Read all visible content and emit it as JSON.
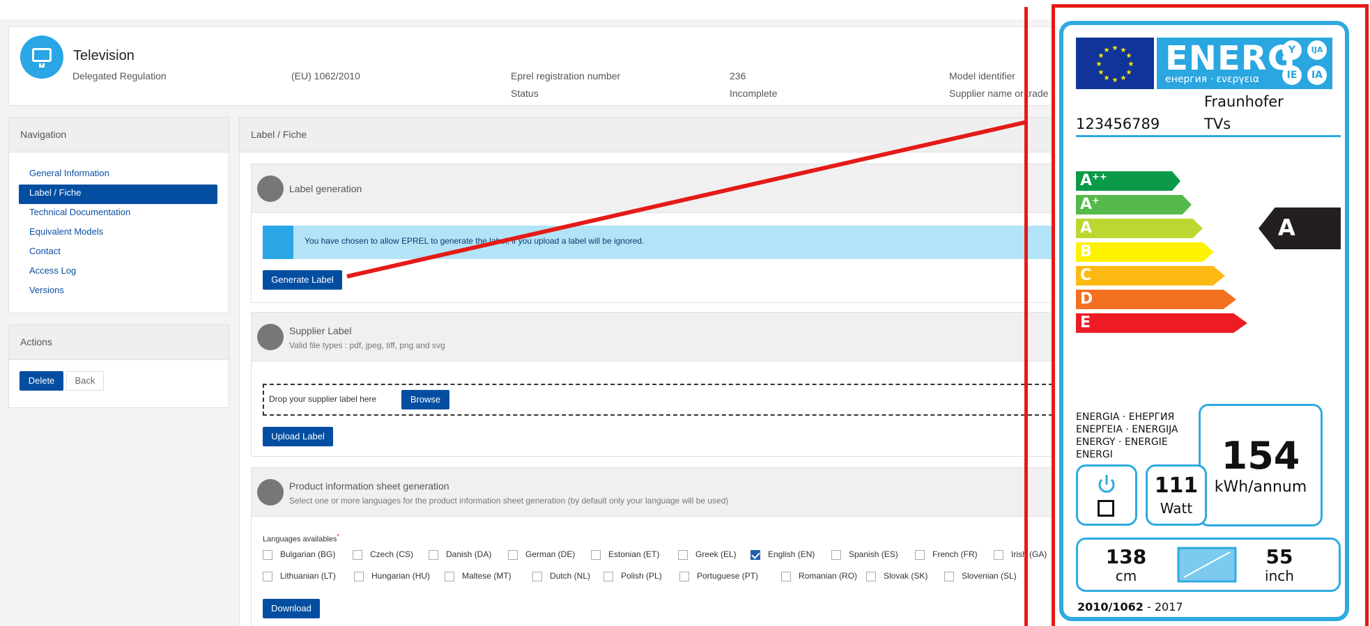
{
  "header": {
    "title": "Television",
    "fields": [
      {
        "label": "Delegated Regulation",
        "value": "(EU) 1062/2010"
      },
      {
        "label": "Eprel registration number",
        "value": "236"
      },
      {
        "label": "Status",
        "value": "Incomplete"
      },
      {
        "label": "Model identifier",
        "value": ""
      },
      {
        "label": "Supplier name or trade",
        "value": ""
      }
    ]
  },
  "navigation": {
    "title": "Navigation",
    "items": [
      {
        "label": "General Information",
        "active": false
      },
      {
        "label": "Label / Fiche",
        "active": true
      },
      {
        "label": "Technical Documentation",
        "active": false
      },
      {
        "label": "Equivalent Models",
        "active": false
      },
      {
        "label": "Contact",
        "active": false
      },
      {
        "label": "Access Log",
        "active": false
      },
      {
        "label": "Versions",
        "active": false
      }
    ]
  },
  "actions": {
    "title": "Actions",
    "delete_label": "Delete",
    "back_label": "Back"
  },
  "main": {
    "title": "Label / Fiche",
    "label_generation": {
      "title": "Label generation",
      "info": "You have chosen to allow EPREL to generate the label, if you upload a label will be ignored.",
      "button": "Generate Label"
    },
    "supplier_label": {
      "title": "Supplier Label",
      "subtitle": "Valid file types : pdf, jpeg, tiff, png and svg",
      "drop_text": "Drop your supplier label here",
      "browse": "Browse",
      "upload": "Upload Label"
    },
    "product_sheet": {
      "title": "Product information sheet generation",
      "subtitle": "Select one or more languages for the product information sheet generation (by default only your language will be used)",
      "languages_label": "Languages availables",
      "required_mark": "*",
      "row1": [
        {
          "label": "Bulgarian (BG)",
          "checked": false
        },
        {
          "label": "Czech (CS)",
          "checked": false
        },
        {
          "label": "Danish (DA)",
          "checked": false
        },
        {
          "label": "German (DE)",
          "checked": false
        },
        {
          "label": "Estonian (ET)",
          "checked": false
        },
        {
          "label": "Greek (EL)",
          "checked": false
        },
        {
          "label": "English (EN)",
          "checked": true
        },
        {
          "label": "Spanish (ES)",
          "checked": false
        },
        {
          "label": "French (FR)",
          "checked": false
        },
        {
          "label": "Irish (GA)",
          "checked": false
        }
      ],
      "row2": [
        {
          "label": "Lithuanian (LT)",
          "checked": false
        },
        {
          "label": "Hungarian (HU)",
          "checked": false
        },
        {
          "label": "Maltese (MT)",
          "checked": false
        },
        {
          "label": "Dutch (NL)",
          "checked": false
        },
        {
          "label": "Polish (PL)",
          "checked": false
        },
        {
          "label": "Portuguese (PT)",
          "checked": false
        },
        {
          "label": "Romanian (RO)",
          "checked": false
        },
        {
          "label": "Slovak (SK)",
          "checked": false
        },
        {
          "label": "Slovenian (SL)",
          "checked": false
        }
      ],
      "download": "Download"
    }
  },
  "energy_label": {
    "energ_text": "ENERG",
    "energ_sub": "енергия · ενεργεια",
    "pills": [
      "Y",
      "IJA",
      "IE",
      "IA"
    ],
    "supplier": "Fraunhofer",
    "model_id": "123456789",
    "model": "TVs",
    "classes": [
      {
        "letter": "A",
        "sup": "++",
        "color": "#0a9a48"
      },
      {
        "letter": "A",
        "sup": "+",
        "color": "#54b948"
      },
      {
        "letter": "A",
        "sup": "",
        "color": "#bed630"
      },
      {
        "letter": "B",
        "sup": "",
        "color": "#fff200"
      },
      {
        "letter": "C",
        "sup": "",
        "color": "#fdb913"
      },
      {
        "letter": "D",
        "sup": "",
        "color": "#f37021"
      },
      {
        "letter": "E",
        "sup": "",
        "color": "#ed1c24"
      }
    ],
    "rating": "A",
    "energy_words": [
      "ENERGIA · ЕНЕРГИЯ",
      "ΕΝΕΡΓΕΙΑ · ENERGIJA",
      "ENERGY · ENERGIE",
      "ENERGI"
    ],
    "power_value": "111",
    "power_unit": "Watt",
    "annual_value": "154",
    "annual_unit": "kWh/annum",
    "diag_cm": "138",
    "cm_unit": "cm",
    "diag_inch": "55",
    "inch_unit": "inch",
    "regulation": "2010/1062",
    "year": "- 2017"
  },
  "colors": {
    "primary": "#034ea1",
    "info": "#b3e3f7",
    "annotation": "#e41b17",
    "label_blue": "#2eaae1"
  }
}
